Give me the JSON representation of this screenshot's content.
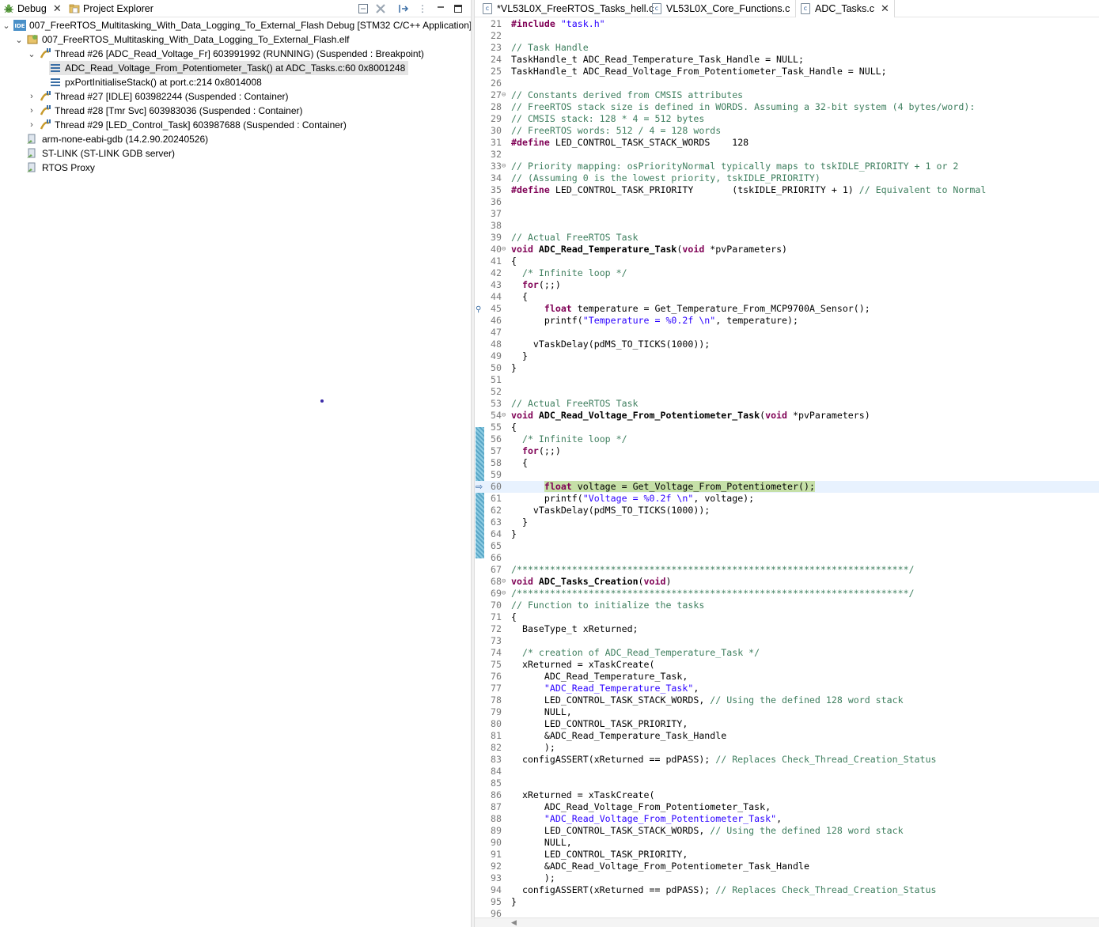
{
  "left_tabs": {
    "debug_label": "Debug",
    "project_explorer_label": "Project Explorer"
  },
  "debug_tree": {
    "launch": "007_FreeRTOS_Multitasking_With_Data_Logging_To_External_Flash Debug [STM32 C/C++ Application]",
    "elf": "007_FreeRTOS_Multitasking_With_Data_Logging_To_External_Flash.elf",
    "thread26": "Thread #26 [ADC_Read_Voltage_Fr] 603991992 (RUNNING) (Suspended : Breakpoint)",
    "frame0": "ADC_Read_Voltage_From_Potentiometer_Task() at ADC_Tasks.c:60 0x8001248",
    "frame1": "pxPortInitialiseStack() at port.c:214 0x8014008",
    "thread27": "Thread #27 [IDLE] 603982244 (Suspended : Container)",
    "thread28": "Thread #28 [Tmr Svc] 603983036 (Suspended : Container)",
    "thread29": "Thread #29 [LED_Control_Task] 603987688 (Suspended : Container)",
    "gdb": "arm-none-eabi-gdb (14.2.90.20240526)",
    "stlink": "ST-LINK (ST-LINK GDB server)",
    "rtos": "RTOS Proxy",
    "launch_badge": "IDE"
  },
  "editor_tabs": [
    {
      "label": "*VL53L0X_FreeRTOS_Tasks_hell.c",
      "icon": "c"
    },
    {
      "label": "VL53L0X_Core_Functions.c",
      "icon": "c"
    },
    {
      "label": "ADC_Tasks.c",
      "icon": "c"
    }
  ],
  "code_lines": [
    {
      "n": "21",
      "fold": "",
      "segs": [
        [
          "kw",
          "#include"
        ],
        [
          "",
          ""
        ],
        [
          "st",
          " \"task.h\""
        ]
      ]
    },
    {
      "n": "22",
      "fold": "",
      "segs": []
    },
    {
      "n": "23",
      "fold": "",
      "segs": [
        [
          "cm",
          "// Task Handle"
        ]
      ]
    },
    {
      "n": "24",
      "fold": "",
      "segs": [
        [
          "",
          "TaskHandle_t ADC_Read_Temperature_Task_Handle = NULL;"
        ]
      ]
    },
    {
      "n": "25",
      "fold": "",
      "segs": [
        [
          "",
          "TaskHandle_t ADC_Read_Voltage_From_Potentiometer_Task_Handle = NULL;"
        ]
      ]
    },
    {
      "n": "26",
      "fold": "",
      "segs": []
    },
    {
      "n": "27",
      "fold": "⊖",
      "segs": [
        [
          "cm",
          "// Constants derived from CMSIS attributes"
        ]
      ]
    },
    {
      "n": "28",
      "fold": "",
      "segs": [
        [
          "cm",
          "// FreeRTOS stack size is defined in WORDS. Assuming a 32-bit system (4 bytes/word):"
        ]
      ]
    },
    {
      "n": "29",
      "fold": "",
      "segs": [
        [
          "cm",
          "// CMSIS stack: 128 * 4 = 512 bytes"
        ]
      ]
    },
    {
      "n": "30",
      "fold": "",
      "segs": [
        [
          "cm",
          "// FreeRTOS words: 512 / 4 = 128 words"
        ]
      ]
    },
    {
      "n": "31",
      "fold": "",
      "segs": [
        [
          "kw",
          "#define"
        ],
        [
          "",
          " LED_CONTROL_TASK_STACK_WORDS    128"
        ]
      ]
    },
    {
      "n": "32",
      "fold": "",
      "segs": []
    },
    {
      "n": "33",
      "fold": "⊖",
      "segs": [
        [
          "cm",
          "// Priority mapping: osPriorityNormal typically maps to tskIDLE_PRIORITY + 1 or 2"
        ]
      ]
    },
    {
      "n": "34",
      "fold": "",
      "segs": [
        [
          "cm",
          "// (Assuming 0 is the lowest priority, tskIDLE_PRIORITY)"
        ]
      ]
    },
    {
      "n": "35",
      "fold": "",
      "segs": [
        [
          "kw",
          "#define"
        ],
        [
          "",
          " LED_CONTROL_TASK_PRIORITY       (tskIDLE_PRIORITY + 1) "
        ],
        [
          "cm",
          "// Equivalent to Normal"
        ]
      ]
    },
    {
      "n": "36",
      "fold": "",
      "segs": []
    },
    {
      "n": "37",
      "fold": "",
      "segs": []
    },
    {
      "n": "38",
      "fold": "",
      "segs": []
    },
    {
      "n": "39",
      "fold": "",
      "segs": [
        [
          "cm",
          "// Actual FreeRTOS Task"
        ]
      ]
    },
    {
      "n": "40",
      "fold": "⊖",
      "segs": [
        [
          "kw",
          "void"
        ],
        [
          "",
          " "
        ],
        [
          "fn",
          "ADC_Read_Temperature_Task"
        ],
        [
          "",
          "("
        ],
        [
          "kw",
          "void"
        ],
        [
          "",
          " *pvParameters)"
        ]
      ]
    },
    {
      "n": "41",
      "fold": "",
      "segs": [
        [
          "",
          "{"
        ]
      ]
    },
    {
      "n": "42",
      "fold": "",
      "segs": [
        [
          "",
          "  "
        ],
        [
          "cm",
          "/* Infinite loop */"
        ]
      ]
    },
    {
      "n": "43",
      "fold": "",
      "segs": [
        [
          "",
          "  "
        ],
        [
          "kw",
          "for"
        ],
        [
          "",
          "(;;)"
        ]
      ]
    },
    {
      "n": "44",
      "fold": "",
      "segs": [
        [
          "",
          "  {"
        ]
      ]
    },
    {
      "n": "45",
      "fold": "",
      "segs": [
        [
          "",
          "      "
        ],
        [
          "kw",
          "float"
        ],
        [
          "",
          " temperature = Get_Temperature_From_MCP9700A_Sensor();"
        ]
      ]
    },
    {
      "n": "46",
      "fold": "",
      "segs": [
        [
          "",
          "      printf("
        ],
        [
          "st",
          "\"Temperature = %0.2f \\n\""
        ],
        [
          "",
          ", temperature);"
        ]
      ]
    },
    {
      "n": "47",
      "fold": "",
      "segs": []
    },
    {
      "n": "48",
      "fold": "",
      "segs": [
        [
          "",
          "    vTaskDelay(pdMS_TO_TICKS(1000));"
        ]
      ]
    },
    {
      "n": "49",
      "fold": "",
      "segs": [
        [
          "",
          "  }"
        ]
      ]
    },
    {
      "n": "50",
      "fold": "",
      "segs": [
        [
          "",
          "}"
        ]
      ]
    },
    {
      "n": "51",
      "fold": "",
      "segs": []
    },
    {
      "n": "52",
      "fold": "",
      "segs": []
    },
    {
      "n": "53",
      "fold": "",
      "segs": [
        [
          "cm",
          "// Actual FreeRTOS Task"
        ]
      ]
    },
    {
      "n": "54",
      "fold": "⊖",
      "segs": [
        [
          "kw",
          "void"
        ],
        [
          "",
          " "
        ],
        [
          "fn",
          "ADC_Read_Voltage_From_Potentiometer_Task"
        ],
        [
          "",
          "("
        ],
        [
          "kw",
          "void"
        ],
        [
          "",
          " *pvParameters)"
        ]
      ]
    },
    {
      "n": "55",
      "fold": "",
      "segs": [
        [
          "",
          "{"
        ]
      ]
    },
    {
      "n": "56",
      "fold": "",
      "segs": [
        [
          "",
          "  "
        ],
        [
          "cm",
          "/* Infinite loop */"
        ]
      ]
    },
    {
      "n": "57",
      "fold": "",
      "segs": [
        [
          "",
          "  "
        ],
        [
          "kw",
          "for"
        ],
        [
          "",
          "(;;)"
        ]
      ]
    },
    {
      "n": "58",
      "fold": "",
      "segs": [
        [
          "",
          "  {"
        ]
      ]
    },
    {
      "n": "59",
      "fold": "",
      "segs": []
    },
    {
      "n": "60",
      "fold": "",
      "segs": [
        [
          "",
          "      "
        ],
        [
          "kw",
          "float"
        ],
        [
          "",
          " voltage = Get_Voltage_From_Potentiometer();"
        ]
      ]
    },
    {
      "n": "61",
      "fold": "",
      "segs": [
        [
          "",
          "      printf("
        ],
        [
          "st",
          "\"Voltage = %0.2f \\n\""
        ],
        [
          "",
          ", voltage);"
        ]
      ]
    },
    {
      "n": "62",
      "fold": "",
      "segs": [
        [
          "",
          "    vTaskDelay(pdMS_TO_TICKS(1000));"
        ]
      ]
    },
    {
      "n": "63",
      "fold": "",
      "segs": [
        [
          "",
          "  }"
        ]
      ]
    },
    {
      "n": "64",
      "fold": "",
      "segs": [
        [
          "",
          "}"
        ]
      ]
    },
    {
      "n": "65",
      "fold": "",
      "segs": []
    },
    {
      "n": "66",
      "fold": "",
      "segs": []
    },
    {
      "n": "67",
      "fold": "",
      "segs": [
        [
          "cm",
          "/***********************************************************************/"
        ]
      ]
    },
    {
      "n": "68",
      "fold": "⊖",
      "segs": [
        [
          "kw",
          "void"
        ],
        [
          "",
          " "
        ],
        [
          "fn",
          "ADC_Tasks_Creation"
        ],
        [
          "",
          "("
        ],
        [
          "kw",
          "void"
        ],
        [
          "",
          ")"
        ]
      ]
    },
    {
      "n": "69",
      "fold": "⊖",
      "segs": [
        [
          "cm",
          "/***********************************************************************/"
        ]
      ]
    },
    {
      "n": "70",
      "fold": "",
      "segs": [
        [
          "cm",
          "// Function to initialize the tasks"
        ]
      ]
    },
    {
      "n": "71",
      "fold": "",
      "segs": [
        [
          "",
          "{"
        ]
      ]
    },
    {
      "n": "72",
      "fold": "",
      "segs": [
        [
          "",
          "  BaseType_t xReturned;"
        ]
      ]
    },
    {
      "n": "73",
      "fold": "",
      "segs": []
    },
    {
      "n": "74",
      "fold": "",
      "segs": [
        [
          "",
          "  "
        ],
        [
          "cm",
          "/* creation of ADC_Read_Temperature_Task */"
        ]
      ]
    },
    {
      "n": "75",
      "fold": "",
      "segs": [
        [
          "",
          "  xReturned = xTaskCreate("
        ]
      ]
    },
    {
      "n": "76",
      "fold": "",
      "segs": [
        [
          "",
          "      ADC_Read_Temperature_Task,"
        ]
      ]
    },
    {
      "n": "77",
      "fold": "",
      "segs": [
        [
          "",
          "      "
        ],
        [
          "st",
          "\"ADC_Read_Temperature_Task\""
        ],
        [
          "",
          ","
        ]
      ]
    },
    {
      "n": "78",
      "fold": "",
      "segs": [
        [
          "",
          "      LED_CONTROL_TASK_STACK_WORDS, "
        ],
        [
          "cm",
          "// Using the defined 128 word stack"
        ]
      ]
    },
    {
      "n": "79",
      "fold": "",
      "segs": [
        [
          "",
          "      NULL,"
        ]
      ]
    },
    {
      "n": "80",
      "fold": "",
      "segs": [
        [
          "",
          "      LED_CONTROL_TASK_PRIORITY,"
        ]
      ]
    },
    {
      "n": "81",
      "fold": "",
      "segs": [
        [
          "",
          "      &ADC_Read_Temperature_Task_Handle"
        ]
      ]
    },
    {
      "n": "82",
      "fold": "",
      "segs": [
        [
          "",
          "      );"
        ]
      ]
    },
    {
      "n": "83",
      "fold": "",
      "segs": [
        [
          "",
          "  configASSERT(xReturned == pdPASS); "
        ],
        [
          "cm",
          "// Replaces Check_Thread_Creation_Status"
        ]
      ]
    },
    {
      "n": "84",
      "fold": "",
      "segs": []
    },
    {
      "n": "85",
      "fold": "",
      "segs": []
    },
    {
      "n": "86",
      "fold": "",
      "segs": [
        [
          "",
          "  xReturned = xTaskCreate("
        ]
      ]
    },
    {
      "n": "87",
      "fold": "",
      "segs": [
        [
          "",
          "      ADC_Read_Voltage_From_Potentiometer_Task,"
        ]
      ]
    },
    {
      "n": "88",
      "fold": "",
      "segs": [
        [
          "",
          "      "
        ],
        [
          "st",
          "\"ADC_Read_Voltage_From_Potentiometer_Task\""
        ],
        [
          "",
          ","
        ]
      ]
    },
    {
      "n": "89",
      "fold": "",
      "segs": [
        [
          "",
          "      LED_CONTROL_TASK_STACK_WORDS, "
        ],
        [
          "cm",
          "// Using the defined 128 word stack"
        ]
      ]
    },
    {
      "n": "90",
      "fold": "",
      "segs": [
        [
          "",
          "      NULL,"
        ]
      ]
    },
    {
      "n": "91",
      "fold": "",
      "segs": [
        [
          "",
          "      LED_CONTROL_TASK_PRIORITY,"
        ]
      ]
    },
    {
      "n": "92",
      "fold": "",
      "segs": [
        [
          "",
          "      &ADC_Read_Voltage_From_Potentiometer_Task_Handle"
        ]
      ]
    },
    {
      "n": "93",
      "fold": "",
      "segs": [
        [
          "",
          "      );"
        ]
      ]
    },
    {
      "n": "94",
      "fold": "",
      "segs": [
        [
          "",
          "  configASSERT(xReturned == pdPASS); "
        ],
        [
          "cm",
          "// Replaces Check_Thread_Creation_Status"
        ]
      ]
    },
    {
      "n": "95",
      "fold": "",
      "segs": [
        [
          "",
          "}"
        ]
      ]
    },
    {
      "n": "96",
      "fold": "",
      "segs": []
    }
  ],
  "editor": {
    "current_line": "60",
    "breakpoint_line": "45"
  },
  "colors": {
    "keyword": "#7f0055",
    "comment": "#3f7f5f",
    "string": "#2a00ff",
    "current_line_bg": "#e8f2fe",
    "current_stmt_bg": "#c6e0a8"
  }
}
